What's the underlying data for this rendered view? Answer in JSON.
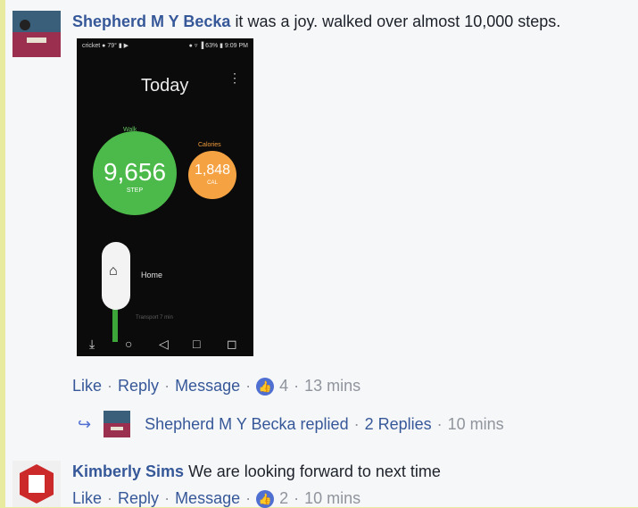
{
  "comment1": {
    "author": "Shepherd M Y Becka",
    "text": "it was a joy. walked over almost 10,000 steps.",
    "actions": {
      "like": "Like",
      "reply": "Reply",
      "message": "Message",
      "like_count": "4",
      "time": "13 mins"
    },
    "replies": {
      "summary": "Shepherd M Y Becka replied",
      "count": "2 Replies",
      "time": "10 mins"
    }
  },
  "phone": {
    "status_left": "cricket ● 79° ▮ ▶",
    "status_right": "● ▿ ▐ 63% ▮ 9:09 PM",
    "title": "Today",
    "walk_label": "Walk",
    "steps_value": "9,656",
    "steps_unit": "STEP",
    "calories_label": "Calories",
    "calories_value": "1,848",
    "calories_unit": "CAL",
    "home_label": "Home",
    "transport_label": "Transport 7 min"
  },
  "comment2": {
    "author": "Kimberly Sims",
    "text": "We are looking forward to next time",
    "actions": {
      "like": "Like",
      "reply": "Reply",
      "message": "Message",
      "like_count": "2",
      "time": "10 mins"
    }
  },
  "colors": {
    "link": "#365899",
    "meta": "#90949c",
    "like_badge": "#4f6fd1",
    "walk": "#4cba4a",
    "calories": "#f5a242"
  }
}
